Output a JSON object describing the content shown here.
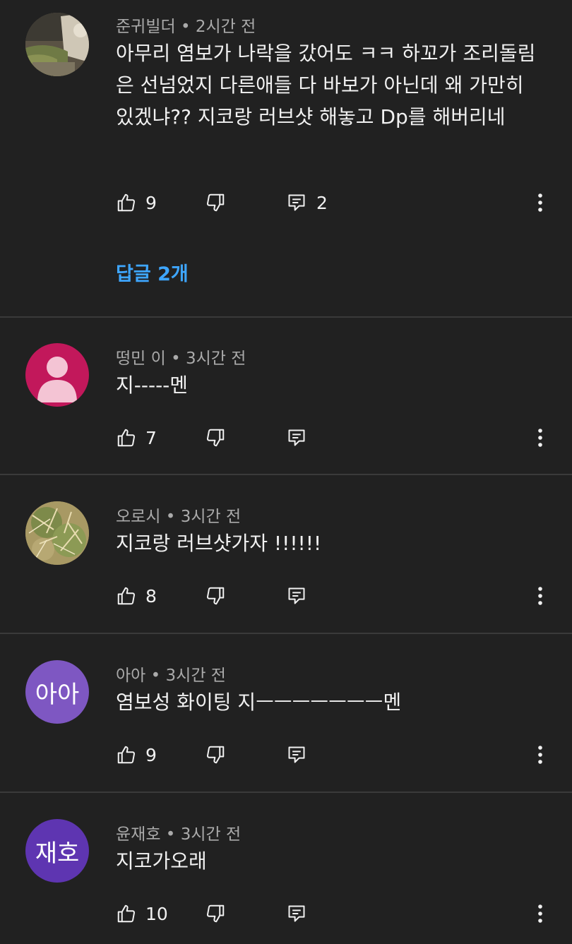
{
  "comments": [
    {
      "author": "준귀빌더",
      "time": "2시간 전",
      "text": "아무리 염보가 나락을 갔어도 ㅋㅋ 하꼬가 조리돌림은 선넘었지 다른애들 다 바보가 아닌데 왜 가만히 있겠냐?? 지코랑 러브샷 해놓고 Dp를 해버리네",
      "likes": "9",
      "reply_count": "2",
      "replies_link": "답글 2개",
      "avatar": {
        "type": "photo",
        "icon": "landscape-photo-avatar"
      }
    },
    {
      "author": "떵민 이",
      "time": "3시간 전",
      "text": "지-----멘",
      "likes": "7",
      "avatar": {
        "type": "default-person",
        "color": "#c2185b",
        "icon": "person-icon"
      }
    },
    {
      "author": "오로시",
      "time": "3시간 전",
      "text": "지코랑 러브샷가자 !!!!!!",
      "likes": "8",
      "avatar": {
        "type": "photo",
        "icon": "cactus-photo-avatar"
      }
    },
    {
      "author": "아아",
      "time": "3시간 전",
      "text": "염보성 화이팅 지ㅡㅡㅡㅡㅡㅡㅡ멘",
      "likes": "9",
      "avatar": {
        "type": "initials",
        "text": "아아",
        "color": "#7e57c2"
      }
    },
    {
      "author": "윤재호",
      "time": "3시간 전",
      "text": "지코가오래",
      "likes": "10",
      "avatar": {
        "type": "initials",
        "text": "재호",
        "color": "#5e35b1"
      }
    }
  ],
  "meta_separator": "•",
  "icons": {
    "like": "thumbs-up-icon",
    "dislike": "thumbs-down-icon",
    "reply": "reply-comment-icon",
    "more": "more-vertical-icon"
  },
  "colors": {
    "background": "#212121",
    "divider": "#3a3a3a",
    "link": "#3ea6ff",
    "secondary_text": "#aaaaaa"
  }
}
